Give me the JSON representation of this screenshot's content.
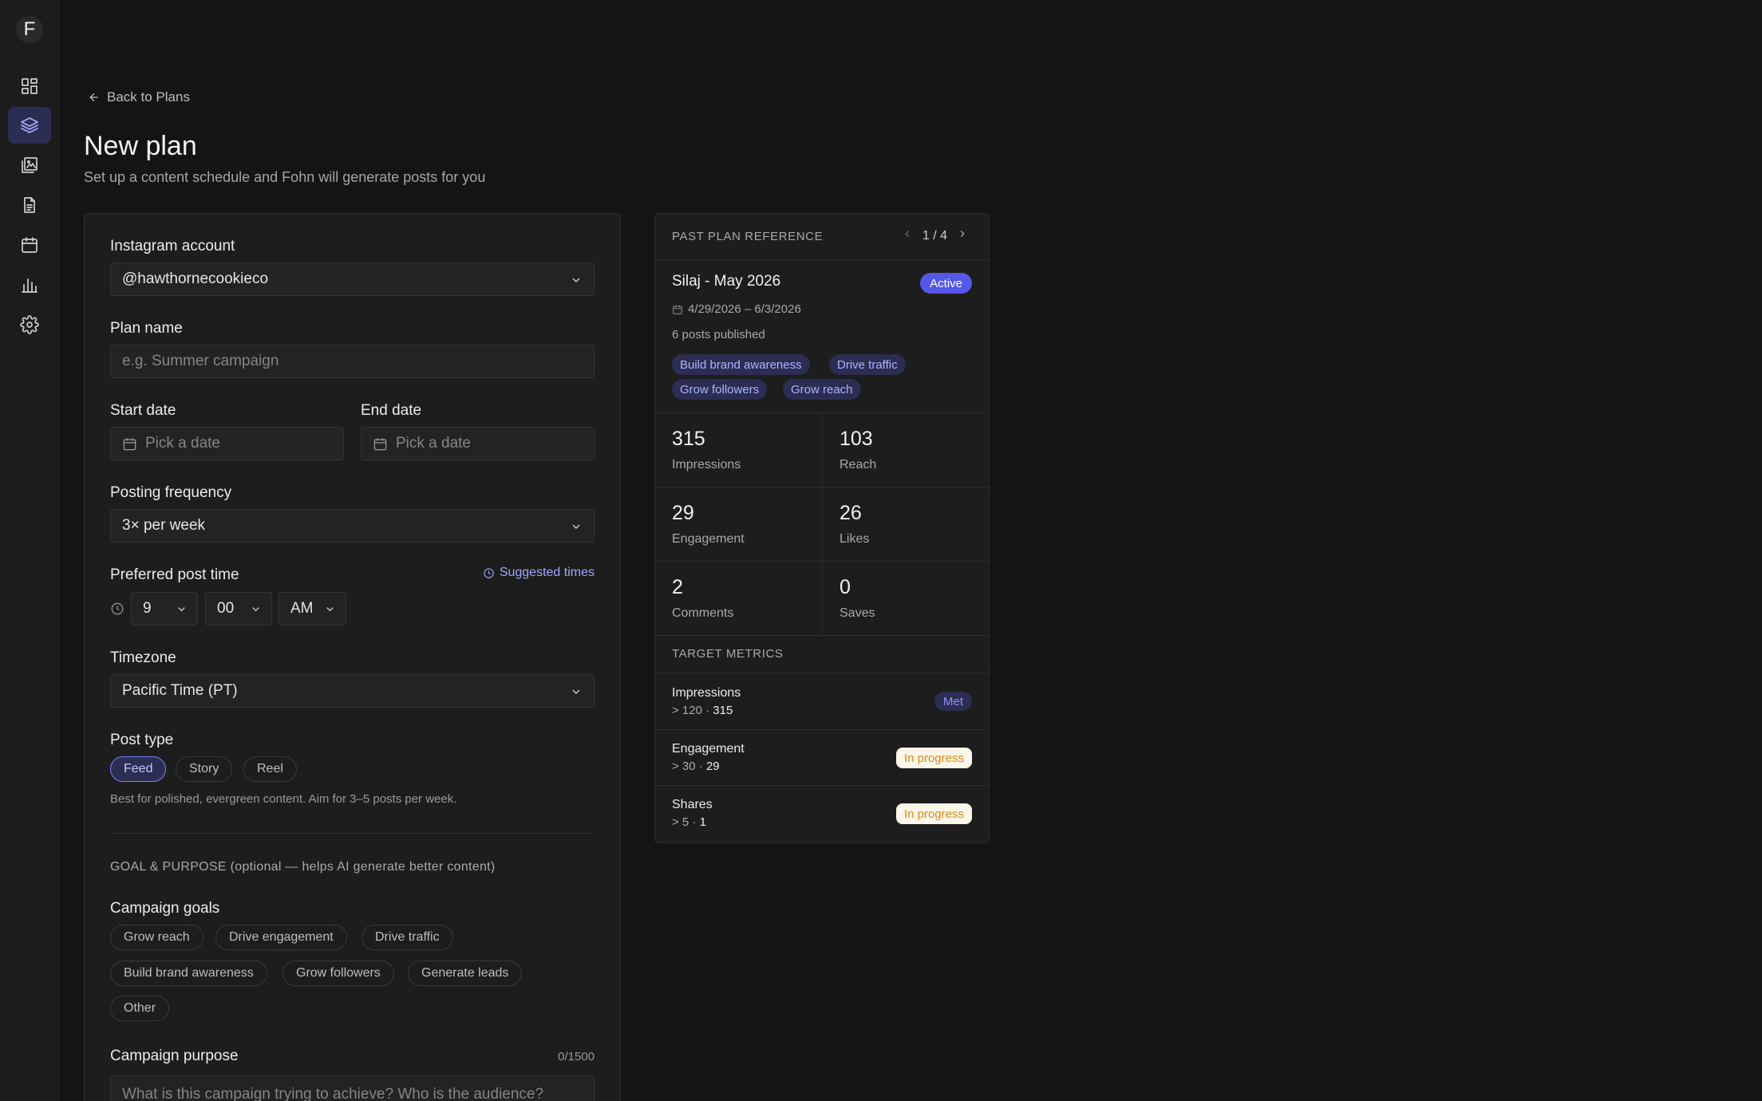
{
  "app": {
    "logo_letter": "F"
  },
  "sidebar": {
    "items": [
      {
        "icon": "dashboard-icon"
      },
      {
        "icon": "layers-icon",
        "active": true
      },
      {
        "icon": "gallery-icon"
      },
      {
        "icon": "document-icon"
      },
      {
        "icon": "calendar-icon"
      },
      {
        "icon": "analytics-icon"
      },
      {
        "icon": "settings-icon"
      }
    ]
  },
  "header": {
    "back_label": "Back to Plans",
    "title": "New plan",
    "subtitle": "Set up a content schedule and Fohn will generate posts for you"
  },
  "form": {
    "account_label": "Instagram account",
    "account_value": "@hawthornecookieco",
    "plan_name_label": "Plan name",
    "plan_name_placeholder": "e.g. Summer campaign",
    "start_date_label": "Start date",
    "start_date_placeholder": "Pick a date",
    "end_date_label": "End date",
    "end_date_placeholder": "Pick a date",
    "frequency_label": "Posting frequency",
    "frequency_value": "3× per week",
    "post_time_label": "Preferred post time",
    "suggested_times": "Suggested times",
    "hour": "9",
    "minute": "00",
    "meridiem": "AM",
    "timezone_label": "Timezone",
    "timezone_value": "Pacific Time (PT)",
    "post_type_label": "Post type",
    "post_types": [
      "Feed",
      "Story",
      "Reel"
    ],
    "post_type_selected": "Feed",
    "post_type_help": "Best for polished, evergreen content. Aim for 3–5 posts per week.",
    "goal_section_caption": "GOAL & PURPOSE (optional — helps AI generate better content)",
    "campaign_goals_label": "Campaign goals",
    "goals": [
      "Grow reach",
      "Drive engagement",
      "Drive traffic",
      "Build brand awareness",
      "Grow followers",
      "Generate leads",
      "Other"
    ],
    "purpose_label": "Campaign purpose",
    "purpose_counter": "0/1500",
    "purpose_placeholder": "What is this campaign trying to achieve? Who is the audience?"
  },
  "reference": {
    "title": "PAST PLAN REFERENCE",
    "pager": "1 / 4",
    "plan_name": "Silaj - May 2026",
    "status": "Active",
    "date_range": "4/29/2026 – 6/3/2026",
    "posts_published": "6 posts published",
    "tags": [
      "Build brand awareness",
      "Drive traffic",
      "Grow followers",
      "Grow reach"
    ],
    "stats": [
      {
        "value": "315",
        "label": "Impressions"
      },
      {
        "value": "103",
        "label": "Reach"
      },
      {
        "value": "29",
        "label": "Engagement"
      },
      {
        "value": "26",
        "label": "Likes"
      },
      {
        "value": "2",
        "label": "Comments"
      },
      {
        "value": "0",
        "label": "Saves"
      }
    ],
    "target_title": "TARGET METRICS",
    "targets": [
      {
        "name": "Impressions",
        "threshold": "> 120 · ",
        "actual": "315",
        "status": "Met"
      },
      {
        "name": "Engagement",
        "threshold": "> 30 · ",
        "actual": "29",
        "status": "In progress"
      },
      {
        "name": "Shares",
        "threshold": "> 5 · ",
        "actual": "1",
        "status": "In progress"
      }
    ]
  },
  "colors": {
    "accent": "#5557e8",
    "accent_soft": "#2b2d52",
    "progress_text": "#d68a1c",
    "background": "#141414"
  }
}
